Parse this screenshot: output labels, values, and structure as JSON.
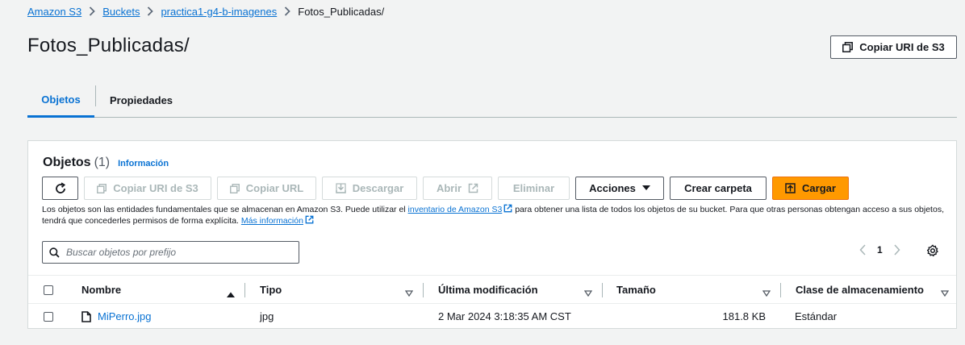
{
  "breadcrumb": {
    "items": [
      "Amazon S3",
      "Buckets",
      "practica1-g4-b-imagenes"
    ],
    "current": "Fotos_Publicadas/"
  },
  "page": {
    "title": "Fotos_Publicadas/",
    "copy_uri_label": "Copiar URI de S3"
  },
  "tabs": [
    {
      "label": "Objetos",
      "active": true
    },
    {
      "label": "Propiedades",
      "active": false
    }
  ],
  "objects_panel": {
    "title": "Objetos",
    "count": "(1)",
    "info_link": "Información",
    "toolbar": {
      "refresh_icon": "refresh-icon",
      "copy_uri": "Copiar URI de S3",
      "copy_url": "Copiar URL",
      "download": "Descargar",
      "open": "Abrir",
      "delete": "Eliminar",
      "actions": "Acciones",
      "create_folder": "Crear carpeta",
      "upload": "Cargar"
    },
    "description": {
      "part1": "Los objetos son las entidades fundamentales que se almacenan en Amazon S3. Puede utilizar el ",
      "inventory_link": "inventario de Amazon S3",
      "part2": " para obtener una lista de todos los objetos de su bucket. Para que otras personas obtengan acceso a sus objetos, tendrá que concederles permisos de forma explícita. ",
      "more_info_link": "Más información"
    },
    "search": {
      "placeholder": "Buscar objetos por prefijo",
      "value": ""
    },
    "pagination": {
      "current_page": "1"
    },
    "table": {
      "columns": [
        "Nombre",
        "Tipo",
        "Última modificación",
        "Tamaño",
        "Clase de almacenamiento"
      ],
      "rows": [
        {
          "name": "MiPerro.jpg",
          "type": "jpg",
          "last_modified": "2 Mar 2024 3:18:35 AM CST",
          "size": "181.8 KB",
          "storage_class": "Estándar"
        }
      ]
    }
  },
  "colors": {
    "link": "#0972d3",
    "primary_button": "#ff9900",
    "background": "#f2f3f3"
  }
}
